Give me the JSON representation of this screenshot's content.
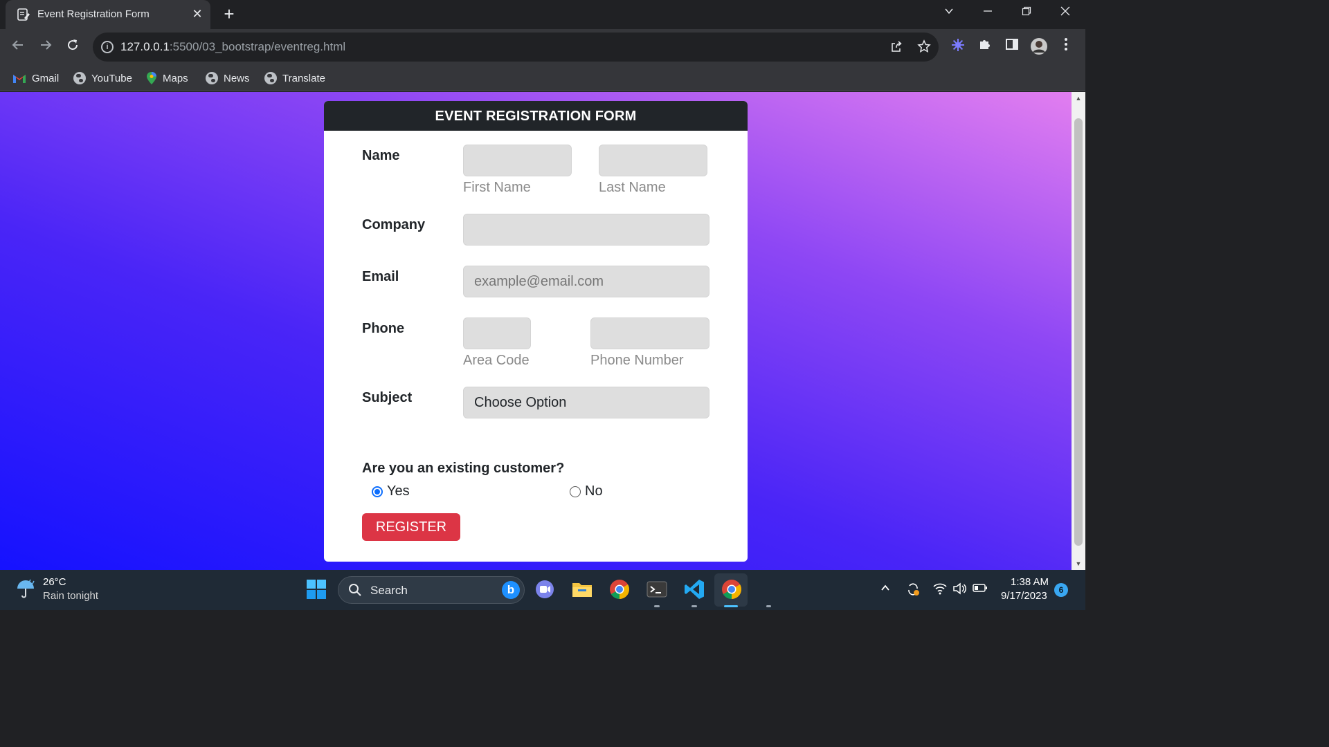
{
  "browser": {
    "tab_title": "Event Registration Form",
    "tab_close": "✕",
    "new_tab": "+",
    "url_host": "127.0.0.1",
    "url_path": ":5500/03_bootstrap/eventreg.html",
    "bookmarks": [
      "Gmail",
      "YouTube",
      "Maps",
      "News",
      "Translate"
    ]
  },
  "form": {
    "header": "EVENT REGISTRATION FORM",
    "name_label": "Name",
    "first_name_hint": "First Name",
    "last_name_hint": "Last Name",
    "first_name_value": "",
    "last_name_value": "",
    "company_label": "Company",
    "company_value": "",
    "email_label": "Email",
    "email_placeholder": "example@email.com",
    "phone_label": "Phone",
    "area_code_hint": "Area Code",
    "phone_number_hint": "Phone Number",
    "subject_label": "Subject",
    "subject_selected": "Choose Option",
    "customer_question": "Are you an existing customer?",
    "option_yes": "Yes",
    "option_no": "No",
    "selected_option": "Yes",
    "register_label": "REGISTER"
  },
  "taskbar": {
    "temperature": "26°C",
    "weather": "Rain tonight",
    "search_label": "Search",
    "time": "1:38 AM",
    "date": "9/17/2023",
    "notification_count": "6"
  },
  "colors": {
    "header_bg": "#212529",
    "register_bg": "#dc3545",
    "radio_accent": "#0d6efd",
    "gradient_top_right": "#e27ef0",
    "gradient_bottom_left": "#1512ff"
  }
}
